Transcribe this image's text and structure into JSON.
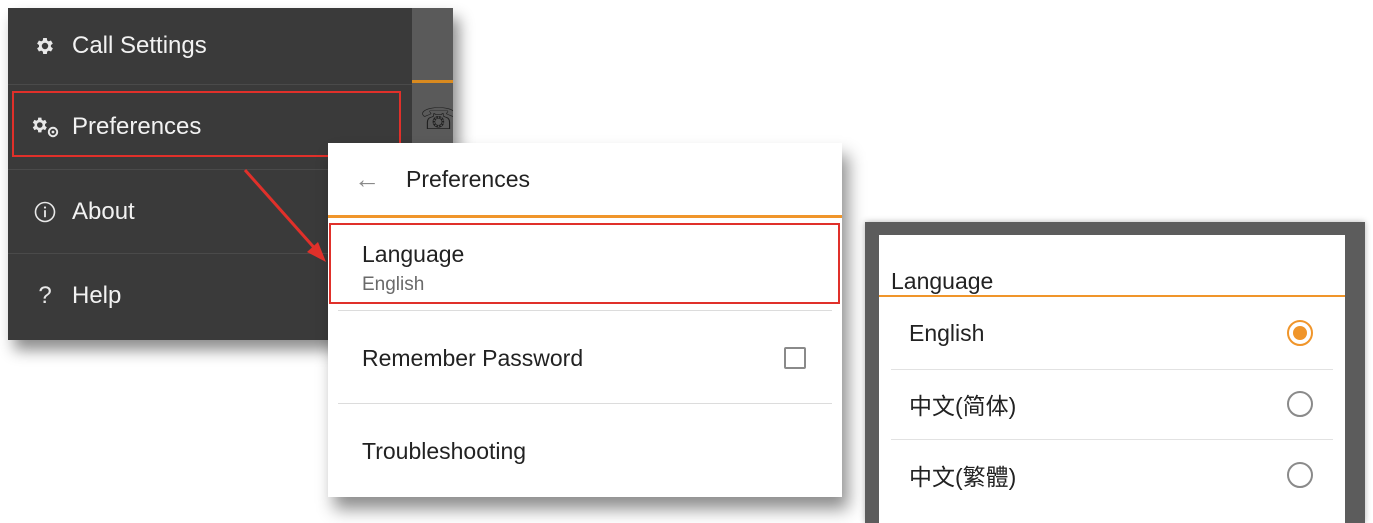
{
  "drawer": {
    "items": [
      {
        "label": "Call Settings",
        "icon": "gear-icon"
      },
      {
        "label": "Preferences",
        "icon": "gears-icon"
      },
      {
        "label": "About",
        "icon": "info-icon"
      },
      {
        "label": "Help",
        "icon": "help-icon"
      }
    ],
    "edge_icon": "call-history-icon"
  },
  "preferences": {
    "title": "Preferences",
    "back_icon": "back-arrow-icon",
    "language_label": "Language",
    "language_value": "English",
    "remember_label": "Remember Password",
    "remember_checked": false,
    "troubleshooting_label": "Troubleshooting"
  },
  "language_dialog": {
    "title": "Language",
    "options": [
      {
        "label": "English",
        "selected": true
      },
      {
        "label": "中文(简体)",
        "selected": false
      },
      {
        "label": "中文(繁體)",
        "selected": false
      }
    ]
  },
  "colors": {
    "accent": "#f0952a",
    "highlight": "#e0302a",
    "drawer_bg": "#3a3a3a"
  }
}
